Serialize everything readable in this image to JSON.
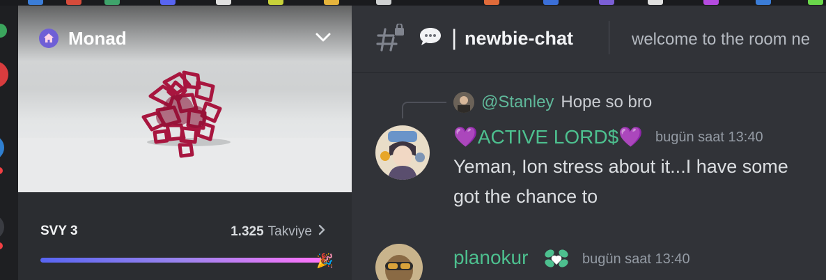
{
  "server": {
    "name": "Monad",
    "boost": {
      "level": "SVY 3",
      "count": "1.325",
      "label": "Takviye",
      "progress": 1.0
    }
  },
  "channel": {
    "name": "newbie-chat",
    "divider": "|",
    "topic": "welcome to the room ne"
  },
  "messages": [
    {
      "reply_to": {
        "user": "@Stanley",
        "text": "Hope so bro"
      },
      "author": "💜ACTIVE LORD$💜",
      "author_color": "#4dc08f",
      "time": "bugün saat 13:40",
      "lines": [
        "Yeman, Ion stress about it...I have some",
        "got the chance to"
      ]
    },
    {
      "author": "planokur",
      "author_color": "#4dc08f",
      "time": "bugün saat 13:40",
      "lines": []
    }
  ],
  "colors": {
    "accent": "#5865f2",
    "chat_bg": "#313338",
    "sidebar_bg": "#2b2d31",
    "rail_bg": "#1e1f22",
    "reply_user": "#5fb89a",
    "timestamp": "#949ba4"
  },
  "icons": {
    "server": "home-icon",
    "dropdown": "chevron-down-icon",
    "channel": "locked-text-channel-icon",
    "channel_emoji": "speech-bubble-icon",
    "boost_arrow": "chevron-right-icon",
    "boost_celebration": "party-popper-icon",
    "role_badge": "leaf-heart-icon"
  }
}
